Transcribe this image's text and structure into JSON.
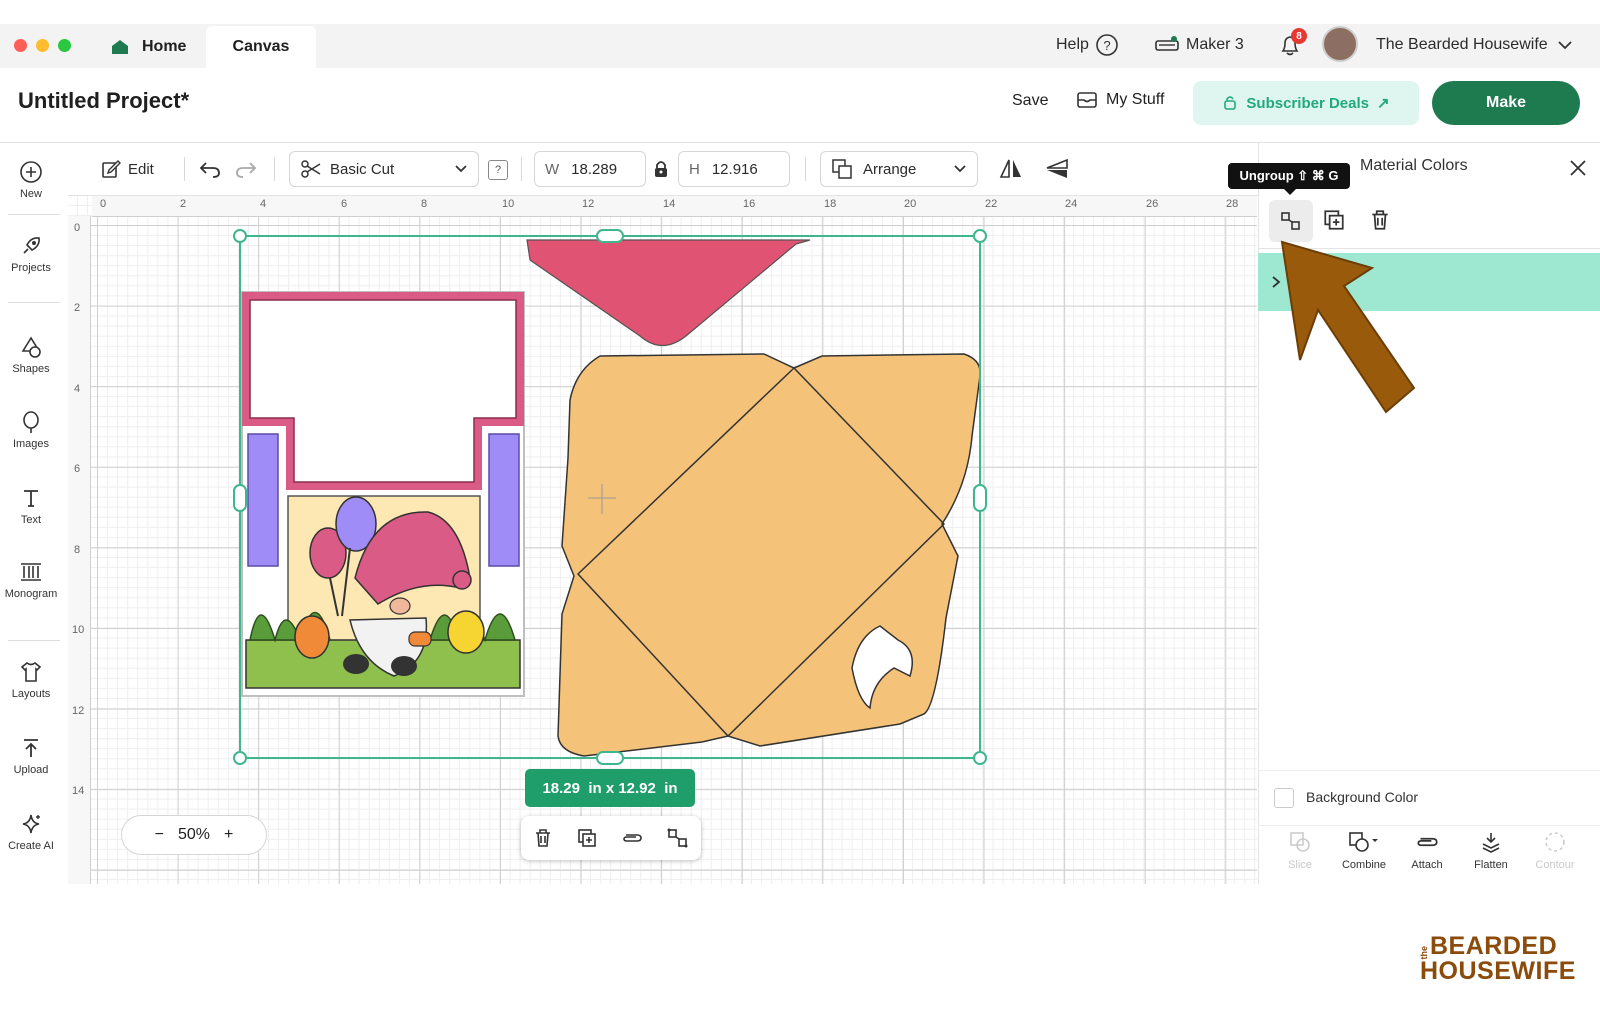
{
  "tabs": {
    "home": "Home",
    "canvas": "Canvas"
  },
  "topbar": {
    "help": "Help",
    "machine": "Maker 3",
    "notification_count": "8",
    "user_name": "The Bearded Housewife"
  },
  "header": {
    "project_title": "Untitled Project*",
    "save": "Save",
    "my_stuff": "My Stuff",
    "subscriber_deals": "Subscriber Deals",
    "make": "Make"
  },
  "sidebar": {
    "items": [
      "New",
      "Projects",
      "Shapes",
      "Images",
      "Text",
      "Monogram",
      "Layouts",
      "Upload",
      "Create AI"
    ]
  },
  "toolbar": {
    "edit": "Edit",
    "operation": "Basic Cut",
    "help_mark": "?",
    "w_label": "W",
    "w_value": "18.289",
    "h_label": "H",
    "h_value": "12.916",
    "arrange": "Arrange"
  },
  "ruler": {
    "top": [
      "0",
      "2",
      "4",
      "6",
      "8",
      "10",
      "12",
      "14",
      "16",
      "18",
      "20",
      "22",
      "24",
      "26",
      "28"
    ],
    "left": [
      "0",
      "2",
      "4",
      "6",
      "8",
      "10",
      "12",
      "14"
    ]
  },
  "selection": {
    "size_label": "18.29  in x 12.92  in"
  },
  "zoom": {
    "value": "50%",
    "minus": "−",
    "plus": "+"
  },
  "right_panel": {
    "title": "Material Colors",
    "tooltip": "Ungroup ⇧ ⌘ G",
    "background_color": "Background Color"
  },
  "bottom_tools": [
    "Slice",
    "Combine",
    "Attach",
    "Flatten",
    "Contour"
  ],
  "colors": {
    "accent": "#1e7a4f",
    "selection": "#3fb68b",
    "envelope": "#f5c27a",
    "flap": "#e05373",
    "layer_highlight": "#9ee8d1",
    "arrow": "#9a5a0c"
  },
  "watermark": {
    "line1": "the",
    "line2": "BEARDED",
    "line3": "HOUSEWIFE"
  }
}
